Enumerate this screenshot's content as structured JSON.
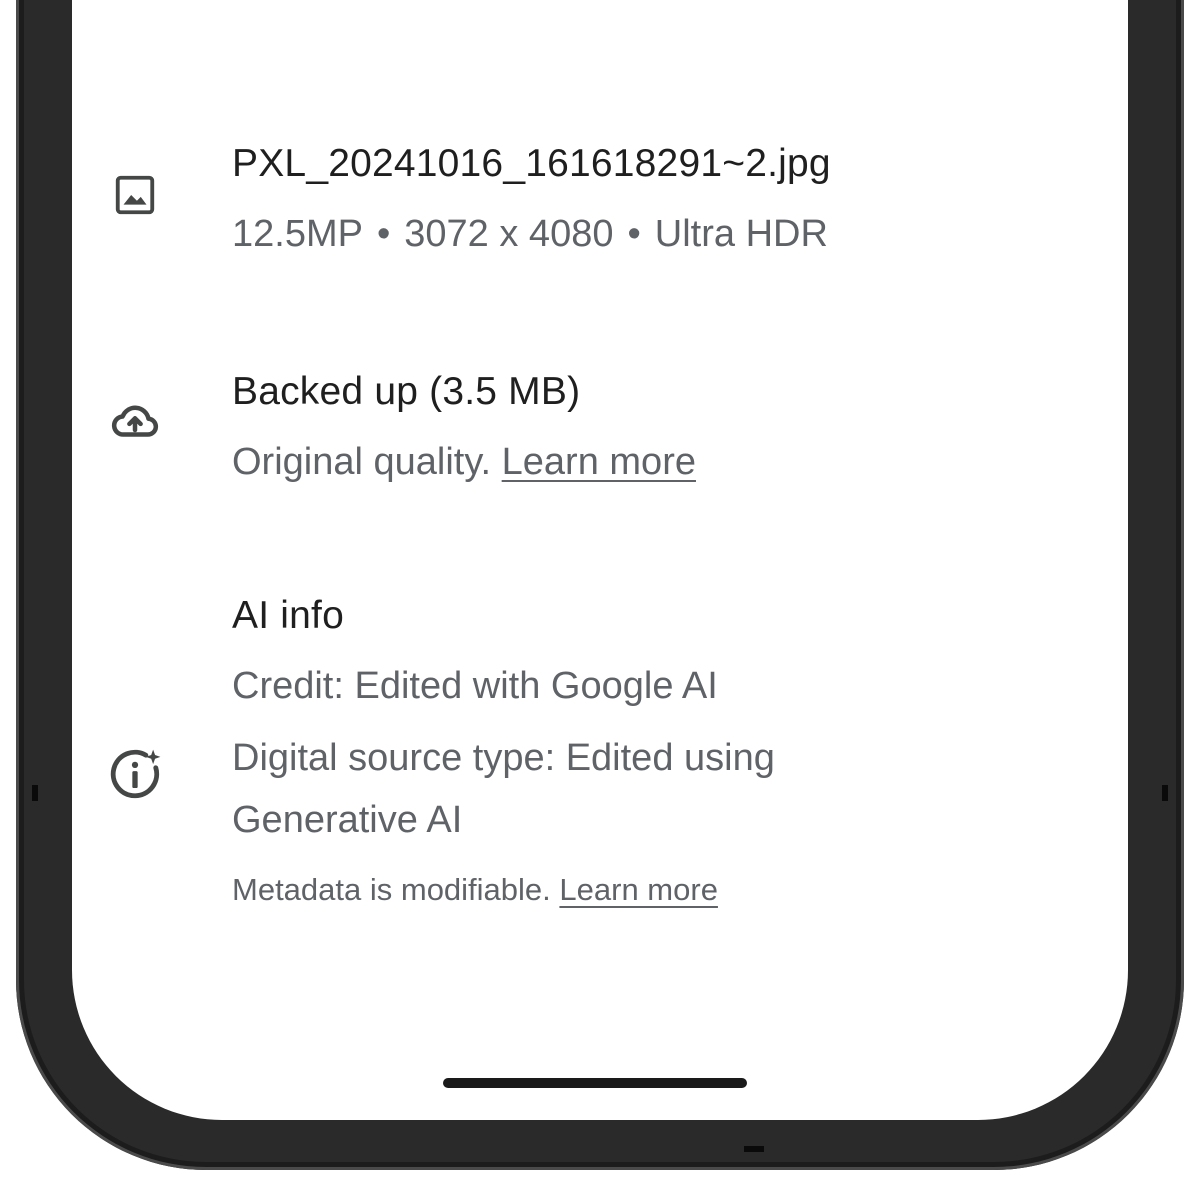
{
  "file_info": {
    "filename": "PXL_20241016_161618291~2.jpg",
    "megapixels": "12.5MP",
    "dimensions": "3072 x 4080",
    "hdr": "Ultra HDR",
    "separator": "•",
    "icon": "image-icon"
  },
  "backup": {
    "title": "Backed up (3.5 MB)",
    "quality": "Original quality.",
    "learn_more": "Learn more",
    "icon": "cloud-upload-icon"
  },
  "ai_info": {
    "title": "AI info",
    "credit": "Credit: Edited with Google AI",
    "source_type_line1": "Digital source type: Edited using",
    "source_type_line2": "Generative AI",
    "metadata_note": "Metadata is modifiable.",
    "learn_more": "Learn more",
    "icon": "ai-info-icon"
  },
  "colors": {
    "title_text": "#1f1f1f",
    "secondary_text": "#5f6368",
    "phone_frame": "#1c1c1c"
  }
}
